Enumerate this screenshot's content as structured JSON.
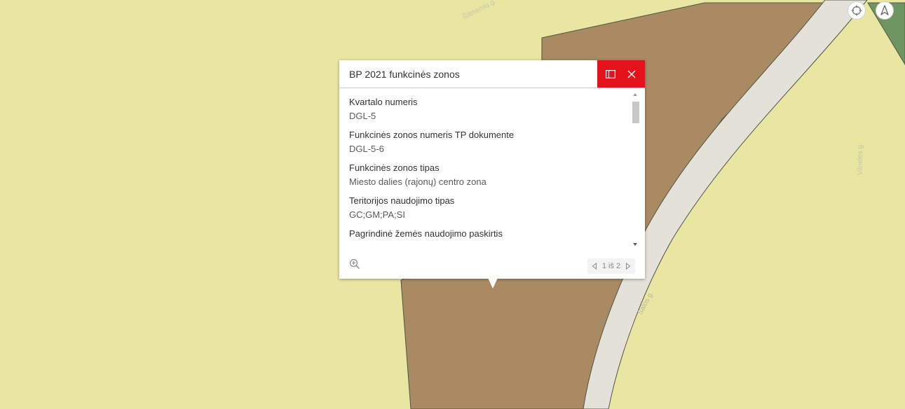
{
  "map": {
    "colors": {
      "residential": "#e8e6a0",
      "central_zone": "#a98a62",
      "road": "#e3e1d8",
      "green": "#6f9660",
      "boundary": "#4f5547"
    },
    "street_labels": [
      "Šiltnamių g.",
      "Salos g.",
      "Vilnelės g."
    ]
  },
  "controls": {
    "locate_icon": "crosshair-icon",
    "compass_icon": "compass-arrow-icon"
  },
  "popup": {
    "title": "BP 2021 funkcinės zonos",
    "header_actions": [
      {
        "name": "dock-icon"
      },
      {
        "name": "close-icon"
      }
    ],
    "fields": [
      {
        "label": "Kvartalo numeris",
        "value": "DGL-5"
      },
      {
        "label": "Funkcinės zonos numeris TP dokumente",
        "value": "DGL-5-6"
      },
      {
        "label": "Funkcinės zonos tipas",
        "value": "Miesto dalies (rajonų) centro zona"
      },
      {
        "label": "Teritorijos naudojimo tipas",
        "value": "GC;GM;PA;SI"
      },
      {
        "label": "Pagrindinė žemės naudojimo paskirtis",
        "value": ""
      }
    ],
    "zoom_icon": "zoom-in-icon",
    "pager": {
      "text": "1 iš 2"
    }
  }
}
